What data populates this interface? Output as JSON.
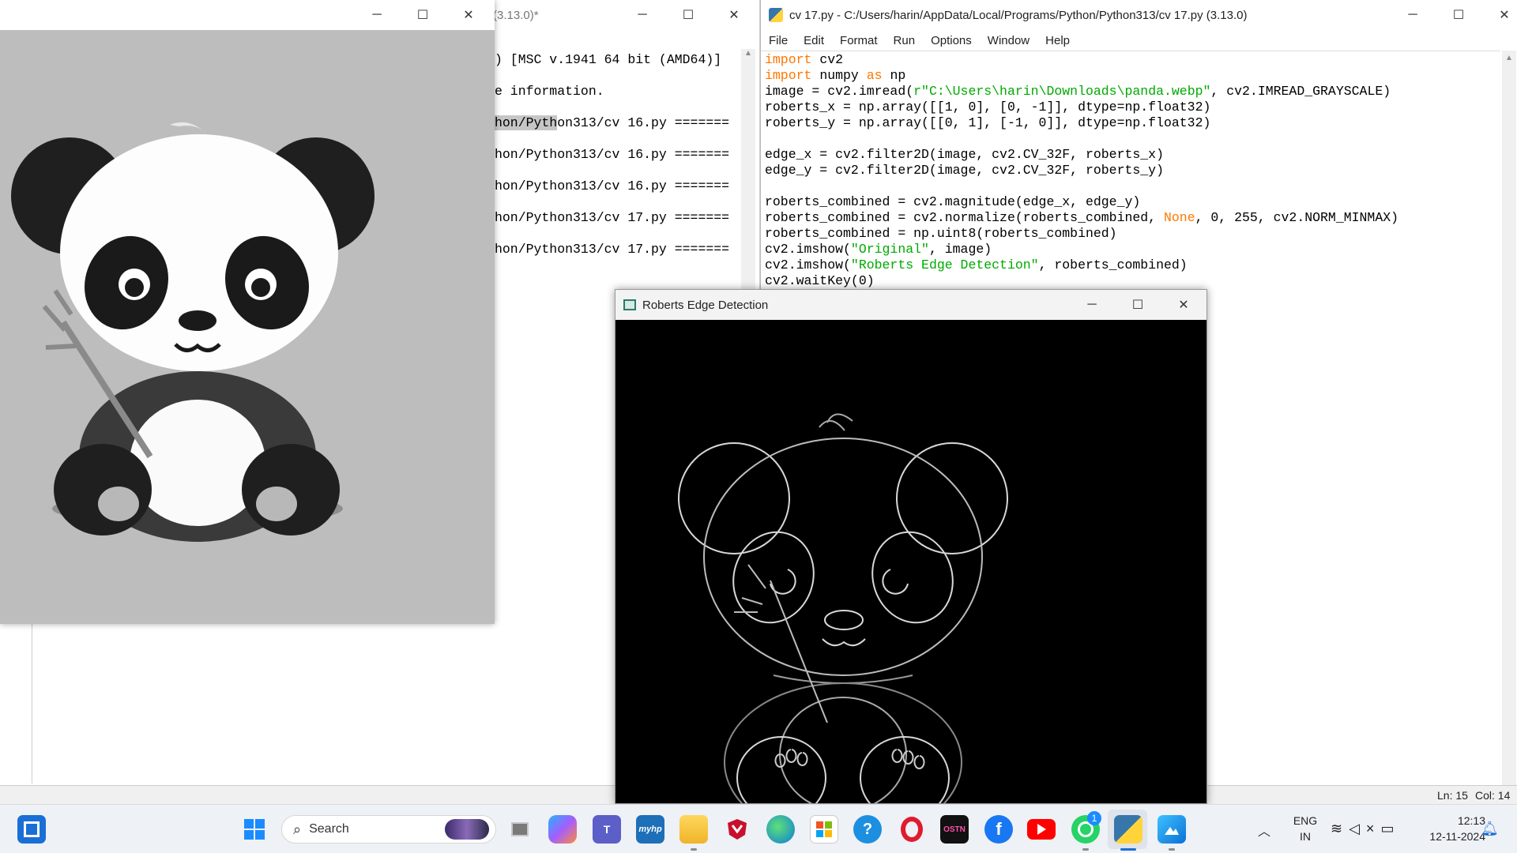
{
  "shell": {
    "title": "(3.13.0)*",
    "lines": [
      ") [MSC v.1941 64 bit (AMD64)]",
      "",
      "e information.",
      "",
      "hon/Python313/cv 16.py =======",
      "",
      "hon/Python313/cv 16.py =======",
      "",
      "hon/Python313/cv 16.py =======",
      "",
      "hon/Python313/cv 17.py =======",
      "",
      "hon/Python313/cv 17.py ======="
    ],
    "highlight": "hon/Pyth"
  },
  "editor": {
    "title": "cv 17.py - C:/Users/harin/AppData/Local/Programs/Python/Python313/cv 17.py (3.13.0)",
    "menu": [
      "File",
      "Edit",
      "Format",
      "Run",
      "Options",
      "Window",
      "Help"
    ],
    "code": [
      [
        [
          "kw",
          "import"
        ],
        [
          "t",
          " cv2"
        ]
      ],
      [
        [
          "kw",
          "import"
        ],
        [
          "t",
          " numpy "
        ],
        [
          "kw",
          "as"
        ],
        [
          "t",
          " np"
        ]
      ],
      [
        [
          "t",
          "image = cv2.imread("
        ],
        [
          "str",
          "r\"C:\\Users\\harin\\Downloads\\panda.webp\""
        ],
        [
          "t",
          ", cv2.IMREAD_GRAYSCALE)"
        ]
      ],
      [
        [
          "t",
          "roberts_x = np.array([[1, 0], [0, -1]], dtype=np.float32)"
        ]
      ],
      [
        [
          "t",
          "roberts_y = np.array([[0, 1], [-1, 0]], dtype=np.float32)"
        ]
      ],
      [
        [
          "t",
          ""
        ]
      ],
      [
        [
          "t",
          "edge_x = cv2.filter2D(image, cv2.CV_32F, roberts_x)"
        ]
      ],
      [
        [
          "t",
          "edge_y = cv2.filter2D(image, cv2.CV_32F, roberts_y)"
        ]
      ],
      [
        [
          "t",
          ""
        ]
      ],
      [
        [
          "t",
          "roberts_combined = cv2.magnitude(edge_x, edge_y)"
        ]
      ],
      [
        [
          "t",
          "roberts_combined = cv2.normalize(roberts_combined, "
        ],
        [
          "kw",
          "None"
        ],
        [
          "t",
          ", 0, 255, cv2.NORM_MINMAX)"
        ]
      ],
      [
        [
          "t",
          "roberts_combined = np.uint8(roberts_combined)"
        ]
      ],
      [
        [
          "t",
          "cv2.imshow("
        ],
        [
          "str",
          "\"Original\""
        ],
        [
          "t",
          ", image)"
        ]
      ],
      [
        [
          "t",
          "cv2.imshow("
        ],
        [
          "str",
          "\"Roberts Edge Detection\""
        ],
        [
          "t",
          ", roberts_combined)"
        ]
      ],
      [
        [
          "t",
          "cv2.waitKey(0)"
        ]
      ]
    ],
    "status_ln": "Ln: 15",
    "status_col": "Col: 14"
  },
  "edge_window": {
    "title": "Roberts Edge Detection"
  },
  "taskbar": {
    "search_placeholder": "Search",
    "lang_top": "ENG",
    "lang_bottom": "IN",
    "time": "12:13",
    "date": "12-11-2024",
    "whatsapp_badge": "1",
    "icons": [
      {
        "name": "widgets-icon",
        "label": ""
      },
      {
        "name": "start-icon",
        "label": ""
      },
      {
        "name": "task-view-icon",
        "label": ""
      },
      {
        "name": "copilot-icon",
        "label": ""
      },
      {
        "name": "teams-icon",
        "label": ""
      },
      {
        "name": "myhp-icon",
        "label": "myhp"
      },
      {
        "name": "file-explorer-icon",
        "label": ""
      },
      {
        "name": "mcafee-icon",
        "label": ""
      },
      {
        "name": "edge-icon",
        "label": ""
      },
      {
        "name": "store-icon",
        "label": ""
      },
      {
        "name": "get-help-icon",
        "label": ""
      },
      {
        "name": "opera-icon",
        "label": ""
      },
      {
        "name": "ostn-icon",
        "label": "OSTN"
      },
      {
        "name": "facebook-icon",
        "label": "f"
      },
      {
        "name": "youtube-icon",
        "label": ""
      },
      {
        "name": "whatsapp-icon",
        "label": ""
      },
      {
        "name": "python-idle-icon",
        "label": ""
      },
      {
        "name": "photos-icon",
        "label": ""
      }
    ]
  }
}
